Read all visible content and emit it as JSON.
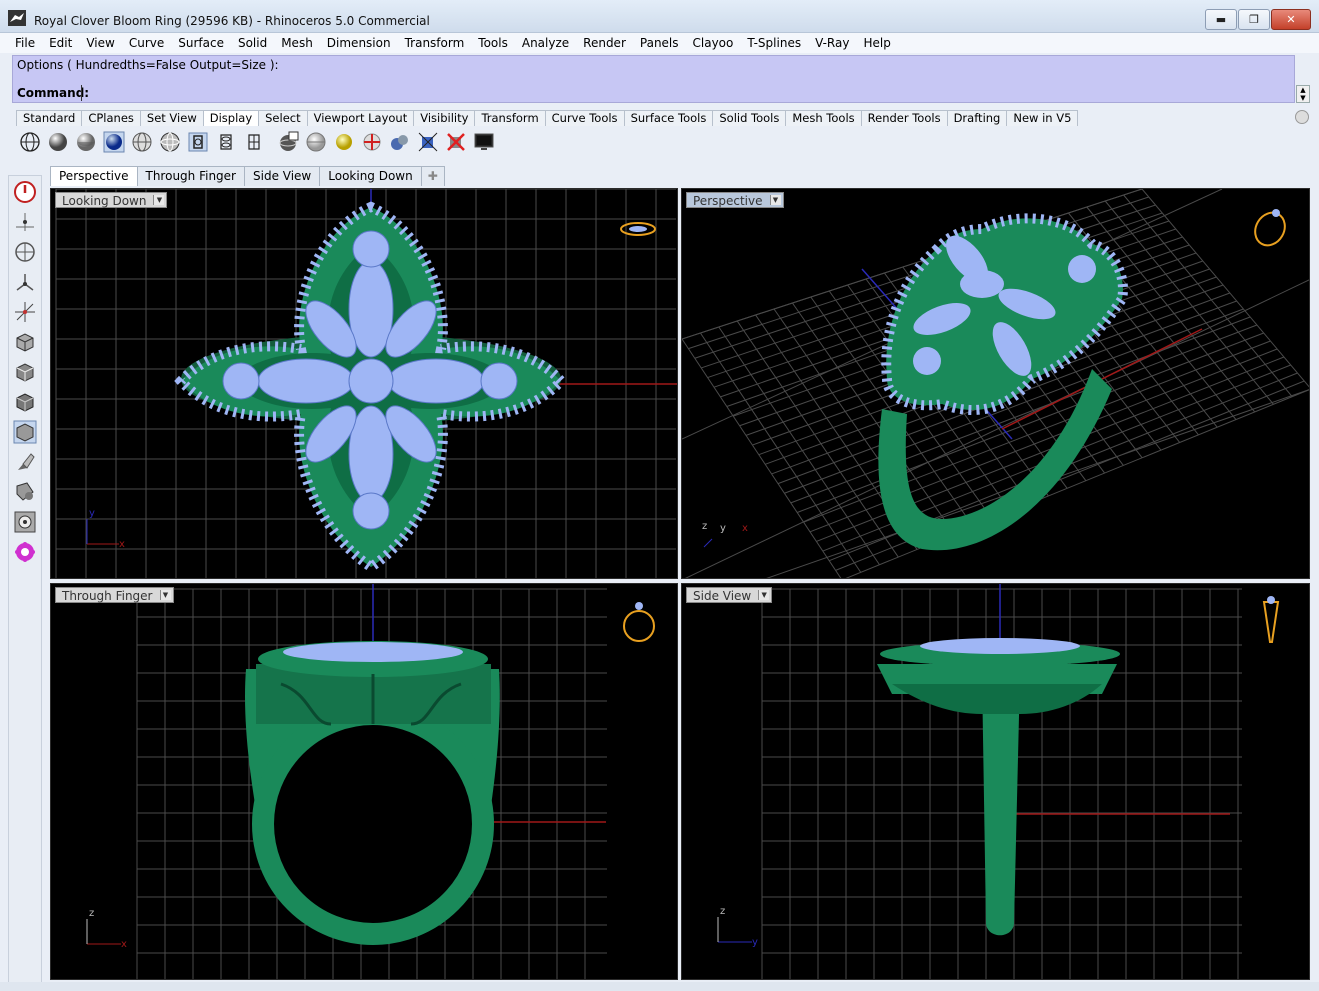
{
  "window": {
    "title": "Royal Clover Bloom Ring (29596 KB) - Rhinoceros 5.0 Commercial",
    "controls": [
      "minimize",
      "maximize",
      "close"
    ]
  },
  "menu": {
    "items": [
      "File",
      "Edit",
      "View",
      "Curve",
      "Surface",
      "Solid",
      "Mesh",
      "Dimension",
      "Transform",
      "Tools",
      "Analyze",
      "Render",
      "Panels",
      "Clayoo",
      "T-Splines",
      "V-Ray",
      "Help"
    ]
  },
  "command": {
    "history": "Options ( Hundredths=False  Output=Size ):",
    "prompt": "Command:",
    "value": ""
  },
  "toolbar_tabs": {
    "items": [
      "Standard",
      "CPlanes",
      "Set View",
      "Display",
      "Select",
      "Viewport Layout",
      "Visibility",
      "Transform",
      "Curve Tools",
      "Surface Tools",
      "Solid Tools",
      "Mesh Tools",
      "Render Tools",
      "Drafting",
      "New in V5"
    ],
    "active": "Display"
  },
  "display_icons": [
    "wireframe-icon",
    "shaded-icon",
    "rendered-icon",
    "render-sphere-icon",
    "ghosted-icon",
    "xray-icon",
    "technical-icon",
    "artistic-icon",
    "pen-icon",
    "display-options-icon",
    "sun-icon",
    "gumball-icon",
    "section-icon",
    "render-mesh-icon",
    "clipping-icon",
    "full-screen-icon"
  ],
  "viewport_tabs": {
    "items": [
      "Perspective",
      "Through Finger",
      "Side View",
      "Looking Down"
    ],
    "active": "Perspective"
  },
  "left_toolbar": [
    "record-history-icon",
    "point-icon",
    "circle-icon",
    "network-icon",
    "transform-icon",
    "box-icon",
    "box-edges-icon",
    "box-faces-icon",
    "box-shaded-icon",
    "brush-icon",
    "render-icon",
    "snap-icon",
    "plugin-icon"
  ],
  "viewports": {
    "top_left": {
      "name": "Looking Down",
      "axes": [
        "y",
        "x"
      ]
    },
    "top_right": {
      "name": "Perspective",
      "axes": [
        "z",
        "y",
        "x"
      ]
    },
    "bottom_left": {
      "name": "Through Finger",
      "axes": [
        "z",
        "x"
      ]
    },
    "bottom_right": {
      "name": "Side View",
      "axes": [
        "z",
        "y"
      ]
    }
  },
  "colors": {
    "metal": "#1a8a5a",
    "gem": "#9fb6f5",
    "grid": "#4a4a4a",
    "axis_x": "#a01818",
    "axis_y": "#2a2ab8",
    "command_bg": "#c7c7f4"
  }
}
